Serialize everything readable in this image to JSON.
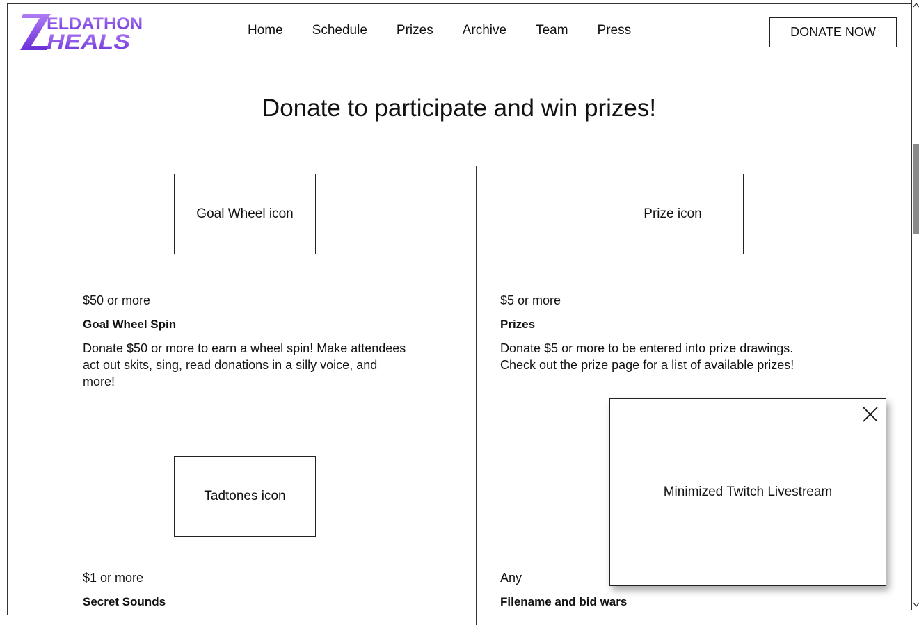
{
  "header": {
    "logo": {
      "line1": "ELDATHON",
      "line2": "HEALS"
    },
    "nav": [
      "Home",
      "Schedule",
      "Prizes",
      "Archive",
      "Team",
      "Press"
    ],
    "donate_button": "DONATE NOW"
  },
  "main": {
    "title": "Donate to participate and win prizes!",
    "cards": [
      {
        "icon_label": "Goal Wheel icon",
        "amount": "$50 or more",
        "name": "Goal Wheel Spin",
        "description": "Donate $50 or more to earn a wheel spin! Make attendees act out skits, sing, read donations in a silly voice, and more!"
      },
      {
        "icon_label": "Prize icon",
        "amount": "$5 or more",
        "name": "Prizes",
        "description": "Donate $5 or more to be entered into prize drawings. Check out the prize page for a list of available prizes!"
      },
      {
        "icon_label": "Tadtones icon",
        "amount": "$1 or more",
        "name": "Secret Sounds"
      },
      {
        "amount": "Any",
        "name": "Filename and bid wars"
      }
    ]
  },
  "popup": {
    "label": "Minimized Twitch Livestream"
  },
  "colors": {
    "logo_purple": "#7b3fe4",
    "logo_light": "#a46cf0"
  }
}
